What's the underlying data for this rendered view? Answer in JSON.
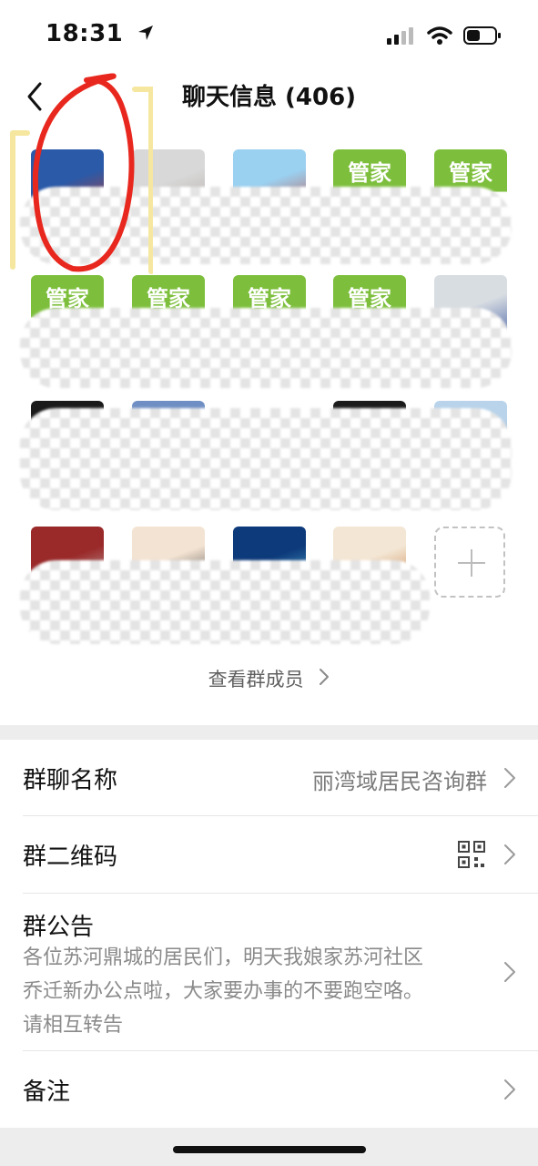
{
  "status": {
    "time": "18:31"
  },
  "nav": {
    "title": "聊天信息 (406)"
  },
  "members": {
    "tiles": [
      {
        "kind": "photo",
        "colors": [
          "#2a5aa8",
          "#c83a2a"
        ]
      },
      {
        "kind": "photo",
        "colors": [
          "#d8d8d8",
          "#b0a6a0"
        ]
      },
      {
        "kind": "photo",
        "colors": [
          "#9ad0f0",
          "#c84a3a"
        ]
      },
      {
        "kind": "guanjia",
        "text": "管家"
      },
      {
        "kind": "guanjia",
        "text": "管家"
      },
      {
        "kind": "guanjia",
        "text": "管家"
      },
      {
        "kind": "guanjia",
        "text": "管家"
      },
      {
        "kind": "guanjia",
        "text": "管家"
      },
      {
        "kind": "guanjia",
        "text": "管家"
      },
      {
        "kind": "photo",
        "colors": [
          "#d8dde2",
          "#3a56a0"
        ]
      },
      {
        "kind": "photo",
        "colors": [
          "#1a1a1a",
          "#f2d6cc"
        ]
      },
      {
        "kind": "photo",
        "colors": [
          "#6f8fc4",
          "#9aa7b0"
        ]
      },
      {
        "kind": "photo",
        "colors": [
          "#ffffff",
          "#7a7a7a"
        ]
      },
      {
        "kind": "photo",
        "colors": [
          "#1b1b1b",
          "#d2b48c"
        ]
      },
      {
        "kind": "photo",
        "colors": [
          "#b8d3ea",
          "#4a6e94"
        ]
      },
      {
        "kind": "photo",
        "colors": [
          "#9a2a2a",
          "#c9c9c9"
        ]
      },
      {
        "kind": "photo",
        "colors": [
          "#f3e3d2",
          "#222222"
        ]
      },
      {
        "kind": "photo",
        "colors": [
          "#0d3a7a",
          "#5fc3e8"
        ]
      },
      {
        "kind": "photo",
        "colors": [
          "#f3e6d4",
          "#c07030"
        ]
      }
    ],
    "add_icon": "plus-icon"
  },
  "view_all_label": "查看群成员",
  "settings": {
    "group_name_label": "群聊名称",
    "group_name_value": "丽湾域居民咨询群",
    "qr_label": "群二维码",
    "qr_icon": "qr-code-icon",
    "notice_label": "群公告",
    "notice_text": "各位苏河鼎城的居民们，明天我娘家苏河社区\n乔迁新办公点啦，大家要办事的不要跑空咯。\n请相互转告",
    "remark_label": "备注"
  },
  "colors": {
    "accent_green": "#7dbf3c",
    "annotation_red": "#e8281e",
    "annotation_yellow": "#f6e7a0"
  }
}
